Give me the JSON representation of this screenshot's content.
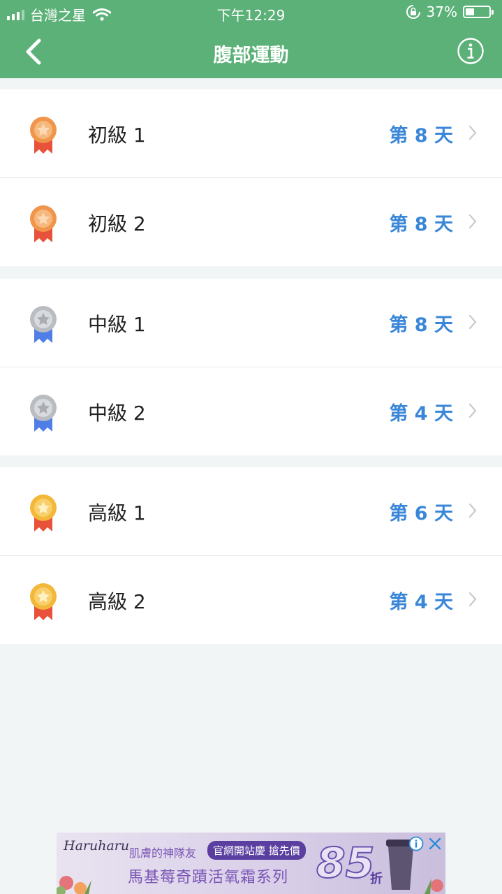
{
  "status_bar": {
    "carrier": "台灣之星",
    "time": "下午12:29",
    "battery": "37%",
    "battery_level": 0.37
  },
  "nav": {
    "title": "腹部運動",
    "back_icon": "chevron-left-icon",
    "info_icon": "info-circle-icon"
  },
  "groups": [
    {
      "medal": "bronze",
      "items": [
        {
          "label": "初級 1",
          "day": "第 8 天"
        },
        {
          "label": "初級 2",
          "day": "第 8 天"
        }
      ]
    },
    {
      "medal": "silver",
      "items": [
        {
          "label": "中級 1",
          "day": "第 8 天"
        },
        {
          "label": "中級 2",
          "day": "第 4 天"
        }
      ]
    },
    {
      "medal": "gold",
      "items": [
        {
          "label": "高級 1",
          "day": "第 6 天"
        },
        {
          "label": "高級 2",
          "day": "第 4 天"
        }
      ]
    }
  ],
  "ad": {
    "brand": "Haruharu",
    "tagline": "肌膚的神隊友",
    "badge": "官網開站慶 搶先價",
    "headline": "馬基莓奇蹟活氧霜系列",
    "discount": "85",
    "discount_unit": "折"
  },
  "colors": {
    "header": "#5bb177",
    "accent_blue": "#3a86d8",
    "background": "#f2f5f6"
  }
}
